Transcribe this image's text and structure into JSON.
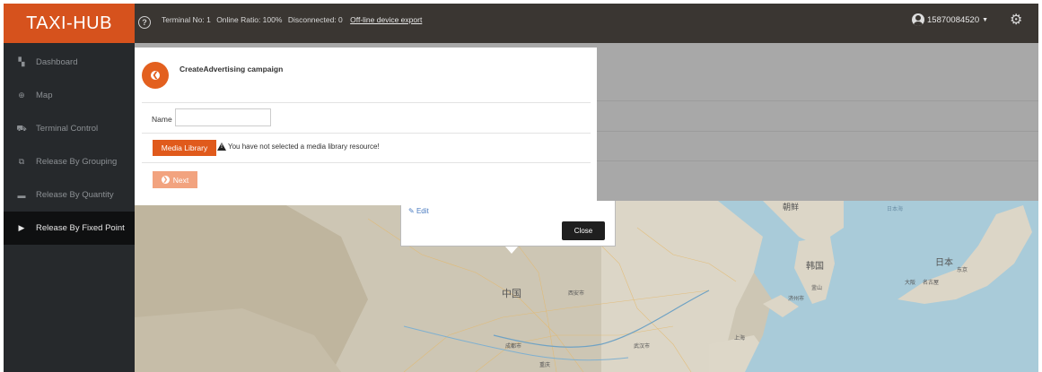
{
  "header": {
    "brand": "TAXI-HUB",
    "help_icon": "question-circle-icon",
    "terminal_no": "Terminal No: 1",
    "online_ratio": "Online Ratio: 100%",
    "disconnected": "Disconnected: 0",
    "export_link": "Off-line device export",
    "user": "15870084520",
    "settings_icon": "gear-icon"
  },
  "sidebar": {
    "items": [
      {
        "label": "Dashboard",
        "icon": "dashboard-icon"
      },
      {
        "label": "Map",
        "icon": "map-icon"
      },
      {
        "label": "Terminal Control",
        "icon": "car-icon"
      },
      {
        "label": "Release By Grouping",
        "icon": "group-icon"
      },
      {
        "label": "Release By Quantity",
        "icon": "list-icon"
      },
      {
        "label": "Release By Fixed Point",
        "icon": "play-icon"
      }
    ],
    "active_index": 5
  },
  "modal": {
    "title": "CreateAdvertising campaign",
    "name_label": "Name",
    "name_value": "",
    "media_button": "Media Library",
    "warning": "You have not selected a media library resource!",
    "next_button": "Next"
  },
  "popup": {
    "edit_label": "Edit",
    "close_label": "Close"
  },
  "map": {
    "labels": [
      "朝鲜",
      "日本海",
      "韩国",
      "日本",
      "东京",
      "大阪",
      "名古屋",
      "中国",
      "西安市",
      "成都市",
      "武汉市",
      "上海",
      "重庆",
      "釜山",
      "济州市"
    ]
  },
  "colors": {
    "brand": "#d6521d",
    "topbar": "#3a3632",
    "sidebar": "#26292c",
    "accent": "#e05a1c"
  }
}
